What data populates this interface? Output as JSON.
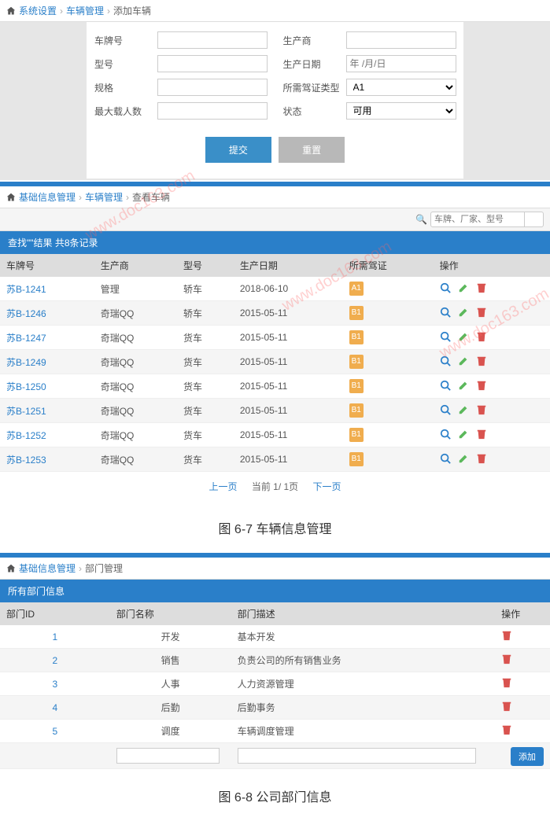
{
  "form_section": {
    "crumb": {
      "l1": "系统设置",
      "l2": "车辆管理",
      "l3": "添加车辆"
    },
    "fields": {
      "plate": "车牌号",
      "maker": "生产商",
      "model": "型号",
      "date": "生产日期",
      "date_ph": "年 /月/日",
      "spec": "规格",
      "license": "所需驾证类型",
      "license_val": "A1",
      "capacity": "最大载人数",
      "status": "状态",
      "status_val": "可用"
    },
    "buttons": {
      "submit": "提交",
      "reset": "重置"
    }
  },
  "list_section": {
    "crumb": {
      "l1": "基础信息管理",
      "l2": "车辆管理",
      "l3": "查看车辆"
    },
    "search_ph": "车牌、厂家、型号",
    "header": "查找\"\"结果  共8条记录",
    "columns": {
      "plate": "车牌号",
      "maker": "生产商",
      "model": "型号",
      "date": "生产日期",
      "license": "所需驾证",
      "action": "操作"
    },
    "rows": [
      {
        "plate": "苏B-1241",
        "maker": "管理",
        "model": "轿车",
        "date": "2018-06-10",
        "badge": "A1",
        "bcolor": "#f0ad4e"
      },
      {
        "plate": "苏B-1246",
        "maker": "奇瑞QQ",
        "model": "轿车",
        "date": "2015-05-11",
        "badge": "B1",
        "bcolor": "#f0ad4e"
      },
      {
        "plate": "苏B-1247",
        "maker": "奇瑞QQ",
        "model": "货车",
        "date": "2015-05-11",
        "badge": "B1",
        "bcolor": "#f0ad4e"
      },
      {
        "plate": "苏B-1249",
        "maker": "奇瑞QQ",
        "model": "货车",
        "date": "2015-05-11",
        "badge": "B1",
        "bcolor": "#f0ad4e"
      },
      {
        "plate": "苏B-1250",
        "maker": "奇瑞QQ",
        "model": "货车",
        "date": "2015-05-11",
        "badge": "B1",
        "bcolor": "#f0ad4e"
      },
      {
        "plate": "苏B-1251",
        "maker": "奇瑞QQ",
        "model": "货车",
        "date": "2015-05-11",
        "badge": "B1",
        "bcolor": "#f0ad4e"
      },
      {
        "plate": "苏B-1252",
        "maker": "奇瑞QQ",
        "model": "货车",
        "date": "2015-05-11",
        "badge": "B1",
        "bcolor": "#f0ad4e"
      },
      {
        "plate": "苏B-1253",
        "maker": "奇瑞QQ",
        "model": "货车",
        "date": "2015-05-11",
        "badge": "B1",
        "bcolor": "#f0ad4e"
      }
    ],
    "pager": {
      "prev": "上一页",
      "info": "当前 1/ 1页",
      "next": "下一页"
    }
  },
  "caption1": "图 6-7 车辆信息管理",
  "dept_section": {
    "crumb": {
      "l1": "基础信息管理",
      "l2": "部门管理"
    },
    "header": "所有部门信息",
    "columns": {
      "id": "部门ID",
      "name": "部门名称",
      "desc": "部门描述",
      "action": "操作"
    },
    "rows": [
      {
        "id": "1",
        "name": "开发",
        "desc": "基本开发"
      },
      {
        "id": "2",
        "name": "销售",
        "desc": "负责公司的所有销售业务"
      },
      {
        "id": "3",
        "name": "人事",
        "desc": "人力资源管理"
      },
      {
        "id": "4",
        "name": "后勤",
        "desc": "后勤事务"
      },
      {
        "id": "5",
        "name": "调度",
        "desc": "车辆调度管理"
      }
    ],
    "add_btn": "添加"
  },
  "caption2": "图 6-8 公司部门信息",
  "watermark": "www.doc163.com"
}
